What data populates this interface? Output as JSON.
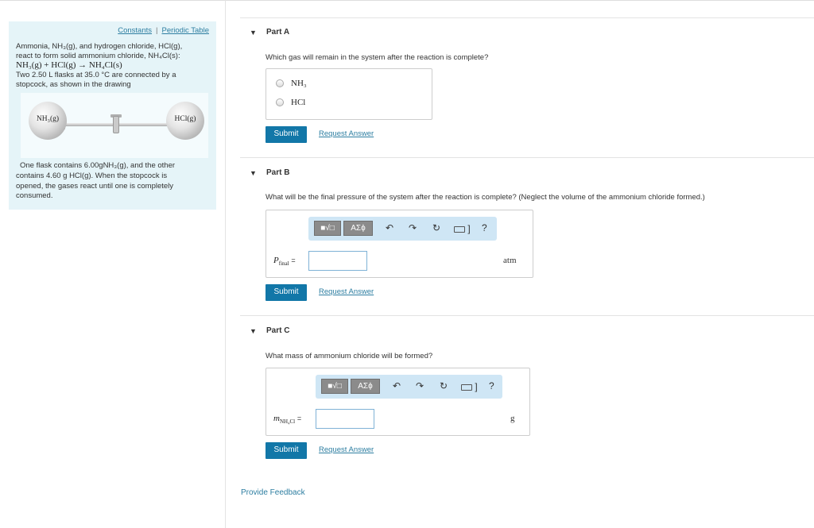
{
  "left_panel": {
    "links": {
      "constants": "Constants",
      "separator": "|",
      "periodic_table": "Periodic Table"
    },
    "intro_line1": "Ammonia, NH₃(g), and hydrogen chloride, HCl(g),",
    "intro_line2": "react to form solid ammonium chloride, NH₄Cl(s):",
    "equation": "NH₃(g) + HCl(g) → NH₄Cl(s)",
    "flasks_line1": "Two 2.50 L flasks at 35.0 °C are connected by a",
    "flasks_line2": "stopcock, as shown in the drawing",
    "flask_left_label": "NH₃(g)",
    "flask_right_label": "HCl(g)",
    "contents_line1": "One flask contains 6.00gNH₃(g), and the other",
    "contents_line2": "contains 4.60 g  HCl(g). When the stopcock is",
    "contents_line3": "opened, the gases react until one is completely",
    "contents_line4": "consumed."
  },
  "partA": {
    "title": "Part A",
    "question": "Which gas will remain in the system after the reaction is complete?",
    "options": [
      "NH₃",
      "HCl"
    ],
    "submit": "Submit",
    "request": "Request Answer"
  },
  "partB": {
    "title": "Part B",
    "question": "What will be the final pressure of the system after the reaction is complete? (Neglect the volume of the ammonium chloride formed.)",
    "var_label": "P",
    "var_sub": "final",
    "equals": "=",
    "input_value": "",
    "unit": "atm",
    "submit": "Submit",
    "request": "Request Answer"
  },
  "partC": {
    "title": "Part C",
    "question": "What mass of ammonium chloride will be formed?",
    "var_label": "m",
    "var_sub": "NH₄Cl",
    "equals": "=",
    "input_value": "",
    "unit": "g",
    "submit": "Submit",
    "request": "Request Answer"
  },
  "toolbar": {
    "template_btn": "■√□",
    "symbols_btn": "ΑΣϕ",
    "undo": "↶",
    "redo": "↷",
    "reset": "↻",
    "help": "?",
    "icons": [
      "templates-icon",
      "greek-symbols-icon",
      "undo-icon",
      "redo-icon",
      "reset-icon",
      "keyboard-icon",
      "help-icon"
    ]
  },
  "footer": {
    "feedback": "Provide Feedback"
  },
  "colors": {
    "accent": "#1277a8",
    "link": "#2d7ea1",
    "panel": "#e5f4f8",
    "toolbar": "#cfe6f5"
  }
}
